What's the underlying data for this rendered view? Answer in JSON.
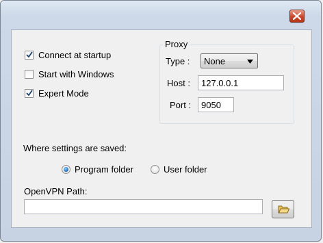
{
  "window": {
    "close_icon": "close-icon"
  },
  "options": {
    "connect_at_startup": {
      "label": "Connect at startup",
      "checked": true
    },
    "start_with_windows": {
      "label": "Start with Windows",
      "checked": false
    },
    "expert_mode": {
      "label": "Expert Mode",
      "checked": true
    }
  },
  "proxy": {
    "group_title": "Proxy",
    "type_label": "Type :",
    "type_value": "None",
    "host_label": "Host :",
    "host_value": "127.0.0.1",
    "port_label": "Port :",
    "port_value": "9050"
  },
  "settings_location": {
    "label": "Where settings are saved:",
    "options": [
      {
        "label": "Program folder",
        "selected": true
      },
      {
        "label": "User folder",
        "selected": false
      }
    ]
  },
  "openvpn": {
    "label": "OpenVPN Path:",
    "value": "",
    "browse_icon": "folder-open-icon"
  },
  "colors": {
    "close_button": "#c9462a",
    "radio_selected": "#1a65b8"
  }
}
